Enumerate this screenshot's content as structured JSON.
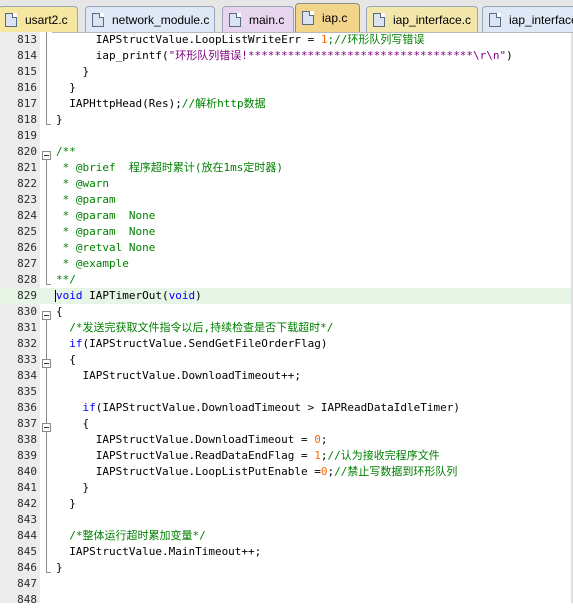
{
  "tabs": [
    {
      "label": "usart2.c",
      "color": "#f5e6a0",
      "active": false
    },
    {
      "label": "network_module.c",
      "color": "#dfe8f7",
      "active": false
    },
    {
      "label": "main.c",
      "color": "#e8d6ef",
      "active": false
    },
    {
      "label": "iap.c",
      "color": "#f2d58a",
      "active": true
    },
    {
      "label": "iap_interface.c",
      "color": "#f4e7ab",
      "active": false
    },
    {
      "label": "iap_interface",
      "color": "#dfe8f7",
      "active": false
    }
  ],
  "colors": {
    "comment": "#008000",
    "string": "#800080",
    "number": "#ff6600",
    "keyword": "#0000ff",
    "text": "#000000"
  },
  "lines": [
    {
      "n": "813",
      "hl": false,
      "segs": [
        {
          "t": "      IAPStructValue.LoopListWriteErr = ",
          "c": "text"
        },
        {
          "t": "1",
          "c": "number"
        },
        {
          "t": ";//环形队列写错误",
          "c": "comment"
        }
      ]
    },
    {
      "n": "814",
      "hl": false,
      "segs": [
        {
          "t": "      iap_printf(",
          "c": "text"
        },
        {
          "t": "\"环形队列错误!**********************************\\r\\n\"",
          "c": "string"
        },
        {
          "t": ")",
          "c": "text"
        }
      ]
    },
    {
      "n": "815",
      "hl": false,
      "segs": [
        {
          "t": "    }",
          "c": "text"
        }
      ]
    },
    {
      "n": "816",
      "hl": false,
      "segs": [
        {
          "t": "  }",
          "c": "text"
        }
      ]
    },
    {
      "n": "817",
      "hl": false,
      "segs": [
        {
          "t": "  IAPHttpHead(Res);",
          "c": "text"
        },
        {
          "t": "//解析http数据",
          "c": "comment"
        }
      ]
    },
    {
      "n": "818",
      "hl": false,
      "segs": [
        {
          "t": "}",
          "c": "text"
        }
      ]
    },
    {
      "n": "819",
      "hl": false,
      "segs": [
        {
          "t": "",
          "c": "text"
        }
      ]
    },
    {
      "n": "820",
      "hl": false,
      "segs": [
        {
          "t": "/**",
          "c": "comment"
        }
      ]
    },
    {
      "n": "821",
      "hl": false,
      "segs": [
        {
          "t": " * @brief  程序超时累计(放在1ms定时器)",
          "c": "comment"
        }
      ]
    },
    {
      "n": "822",
      "hl": false,
      "segs": [
        {
          "t": " * @warn",
          "c": "comment"
        }
      ]
    },
    {
      "n": "823",
      "hl": false,
      "segs": [
        {
          "t": " * @param",
          "c": "comment"
        }
      ]
    },
    {
      "n": "824",
      "hl": false,
      "segs": [
        {
          "t": " * @param  None",
          "c": "comment"
        }
      ]
    },
    {
      "n": "825",
      "hl": false,
      "segs": [
        {
          "t": " * @param  None",
          "c": "comment"
        }
      ]
    },
    {
      "n": "826",
      "hl": false,
      "segs": [
        {
          "t": " * @retval None",
          "c": "comment"
        }
      ]
    },
    {
      "n": "827",
      "hl": false,
      "segs": [
        {
          "t": " * @example",
          "c": "comment"
        }
      ]
    },
    {
      "n": "828",
      "hl": false,
      "segs": [
        {
          "t": "**/",
          "c": "comment"
        }
      ]
    },
    {
      "n": "829",
      "hl": true,
      "segs": [
        {
          "t": "void",
          "c": "keyword"
        },
        {
          "t": " IAPTimerOut(",
          "c": "text"
        },
        {
          "t": "void",
          "c": "keyword"
        },
        {
          "t": ")",
          "c": "text"
        }
      ]
    },
    {
      "n": "830",
      "hl": false,
      "segs": [
        {
          "t": "{",
          "c": "text"
        }
      ]
    },
    {
      "n": "831",
      "hl": false,
      "segs": [
        {
          "t": "  /*发送完获取文件指令以后,持续检查是否下载超时*/",
          "c": "comment"
        }
      ]
    },
    {
      "n": "832",
      "hl": false,
      "segs": [
        {
          "t": "  ",
          "c": "text"
        },
        {
          "t": "if",
          "c": "keyword"
        },
        {
          "t": "(IAPStructValue.SendGetFileOrderFlag)",
          "c": "text"
        }
      ]
    },
    {
      "n": "833",
      "hl": false,
      "segs": [
        {
          "t": "  {",
          "c": "text"
        }
      ]
    },
    {
      "n": "834",
      "hl": false,
      "segs": [
        {
          "t": "    IAPStructValue.DownloadTimeout++;",
          "c": "text"
        }
      ]
    },
    {
      "n": "835",
      "hl": false,
      "segs": [
        {
          "t": "",
          "c": "text"
        }
      ]
    },
    {
      "n": "836",
      "hl": false,
      "segs": [
        {
          "t": "    ",
          "c": "text"
        },
        {
          "t": "if",
          "c": "keyword"
        },
        {
          "t": "(IAPStructValue.DownloadTimeout > IAPReadDataIdleTimer)",
          "c": "text"
        }
      ]
    },
    {
      "n": "837",
      "hl": false,
      "segs": [
        {
          "t": "    {",
          "c": "text"
        }
      ]
    },
    {
      "n": "838",
      "hl": false,
      "segs": [
        {
          "t": "      IAPStructValue.DownloadTimeout = ",
          "c": "text"
        },
        {
          "t": "0",
          "c": "number"
        },
        {
          "t": ";",
          "c": "text"
        }
      ]
    },
    {
      "n": "839",
      "hl": false,
      "segs": [
        {
          "t": "      IAPStructValue.ReadDataEndFlag = ",
          "c": "text"
        },
        {
          "t": "1",
          "c": "number"
        },
        {
          "t": ";",
          "c": "text"
        },
        {
          "t": "//认为接收完程序文件",
          "c": "comment"
        }
      ]
    },
    {
      "n": "840",
      "hl": false,
      "segs": [
        {
          "t": "      IAPStructValue.LoopListPutEnable =",
          "c": "text"
        },
        {
          "t": "0",
          "c": "number"
        },
        {
          "t": ";",
          "c": "text"
        },
        {
          "t": "//禁止写数据到环形队列",
          "c": "comment"
        }
      ]
    },
    {
      "n": "841",
      "hl": false,
      "segs": [
        {
          "t": "    }",
          "c": "text"
        }
      ]
    },
    {
      "n": "842",
      "hl": false,
      "segs": [
        {
          "t": "  }",
          "c": "text"
        }
      ]
    },
    {
      "n": "843",
      "hl": false,
      "segs": [
        {
          "t": "",
          "c": "text"
        }
      ]
    },
    {
      "n": "844",
      "hl": false,
      "segs": [
        {
          "t": "  /*整体运行超时累加变量*/",
          "c": "comment"
        }
      ]
    },
    {
      "n": "845",
      "hl": false,
      "segs": [
        {
          "t": "  IAPStructValue.MainTimeout++;",
          "c": "text"
        }
      ]
    },
    {
      "n": "846",
      "hl": false,
      "segs": [
        {
          "t": "}",
          "c": "text"
        }
      ]
    },
    {
      "n": "847",
      "hl": false,
      "segs": [
        {
          "t": "",
          "c": "text"
        }
      ]
    },
    {
      "n": "848",
      "hl": false,
      "segs": [
        {
          "t": "",
          "c": "text"
        }
      ]
    }
  ]
}
